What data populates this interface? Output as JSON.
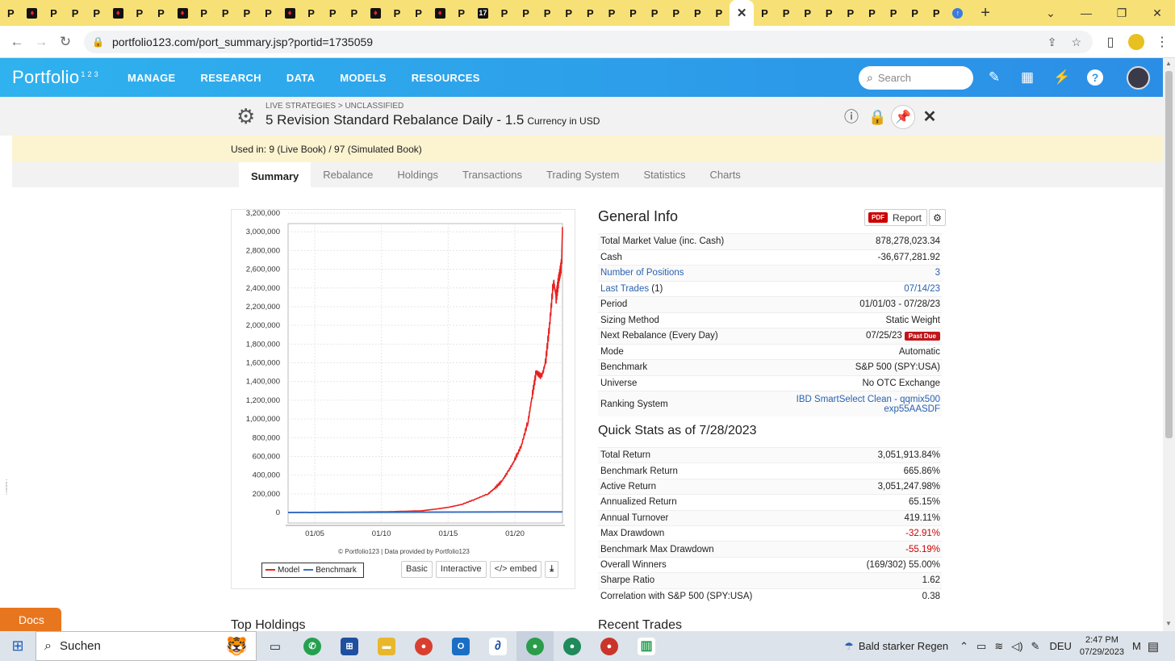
{
  "browser": {
    "tab_favicons": [
      "P",
      "r",
      "P",
      "P",
      "P",
      "r",
      "P",
      "P",
      "r",
      "P",
      "P",
      "P",
      "P",
      "r",
      "P",
      "P",
      "P",
      "r",
      "P",
      "P",
      "r",
      "P",
      "17",
      "P",
      "P",
      "P",
      "P",
      "P",
      "P",
      "P",
      "P",
      "P",
      "P",
      "P",
      "P",
      "P",
      "P",
      "P",
      "P",
      "P",
      "P",
      "P",
      "P",
      "g"
    ],
    "url": "portfolio123.com/port_summary.jsp?portid=1735059"
  },
  "site": {
    "logo_text": "Portfolio",
    "logo_sup": "1 2 3",
    "nav": [
      "MANAGE",
      "RESEARCH",
      "DATA",
      "MODELS",
      "RESOURCES"
    ],
    "search_placeholder": "Search"
  },
  "strategy": {
    "breadcrumb": "LIVE STRATEGIES > UNCLASSIFIED",
    "title": "5 Revision Standard Rebalance Daily - 1.5",
    "currency": "Currency in USD",
    "used_in": "Used in: 9 (Live Book) / 97 (Simulated Book)"
  },
  "tabs": [
    "Summary",
    "Rebalance",
    "Holdings",
    "Transactions",
    "Trading System",
    "Statistics",
    "Charts"
  ],
  "chart": {
    "credit": "© Portfolio123 | Data provided by Portfolio123",
    "legend_model": "Model",
    "legend_benchmark": "Benchmark",
    "buttons": [
      "Basic",
      "Interactive",
      "</> embed"
    ],
    "model_color": "#e8201f",
    "benchmark_color": "#3a6fc4"
  },
  "chart_data": {
    "type": "line",
    "title": "",
    "xlabel": "",
    "ylabel": "",
    "x_ticks": [
      "01/05",
      "01/10",
      "01/15",
      "01/20"
    ],
    "y_ticks": [
      "3,200,000",
      "3,000,000",
      "2,800,000",
      "2,600,000",
      "2,400,000",
      "2,200,000",
      "2,000,000",
      "1,800,000",
      "1,600,000",
      "1,400,000",
      "1,200,000",
      "1,000,000",
      "800,000",
      "600,000",
      "400,000",
      "200,000",
      "0"
    ],
    "ylim": [
      0,
      3200000
    ],
    "xlim": [
      "2003-01-01",
      "2023-07-28"
    ],
    "series": [
      {
        "name": "Model",
        "x": [
          2003,
          2008,
          2010,
          2011,
          2012,
          2013,
          2014,
          2015,
          2016,
          2017,
          2018,
          2018.5,
          2019,
          2019.5,
          2020,
          2020.5,
          2021,
          2021.3,
          2021.6,
          2022,
          2022.3,
          2022.6,
          2022.9,
          2023.1,
          2023.3,
          2023.5,
          2023.57
        ],
        "values": [
          0,
          5000,
          8000,
          10000,
          14000,
          18000,
          35000,
          55000,
          85000,
          140000,
          200000,
          260000,
          330000,
          440000,
          560000,
          720000,
          980000,
          1250000,
          1500000,
          1450000,
          1600000,
          2000000,
          2480000,
          2300000,
          2500000,
          2650000,
          3050000
        ]
      },
      {
        "name": "Benchmark",
        "x": [
          2003,
          2010,
          2015,
          2020,
          2023.57
        ],
        "values": [
          0,
          3000,
          4000,
          6000,
          7000
        ]
      }
    ],
    "grid": true,
    "legend": "bottom-left"
  },
  "general_info": {
    "title": "General Info",
    "report_label": "Report",
    "pdf_label": "PDF",
    "rows": [
      {
        "label": "Total Market Value (inc. Cash)",
        "value": "878,278,023.34"
      },
      {
        "label": "Cash",
        "value": "-36,677,281.92"
      },
      {
        "label": "Number of Positions",
        "value": "3",
        "link": true
      },
      {
        "label": "Last Trades",
        "suffix": "(1)",
        "value": "07/14/23",
        "link": true
      },
      {
        "label": "Period",
        "value": "01/01/03 - 07/28/23"
      },
      {
        "label": "Sizing Method",
        "value": "Static Weight"
      },
      {
        "label": "Next Rebalance (Every Day)",
        "value": "07/25/23",
        "badge": "Past Due"
      },
      {
        "label": "Mode",
        "value": "Automatic"
      },
      {
        "label": "Benchmark",
        "value": "S&P 500 (SPY:USA)"
      },
      {
        "label": "Universe",
        "value": "No OTC Exchange"
      },
      {
        "label": "Ranking System",
        "value": "IBD SmartSelect Clean - qqmix500",
        "value2": "exp55AASDF",
        "link": true
      }
    ]
  },
  "quick_stats": {
    "title": "Quick Stats as of 7/28/2023",
    "rows": [
      {
        "label": "Total Return",
        "value": "3,051,913.84%"
      },
      {
        "label": "Benchmark Return",
        "value": "665.86%"
      },
      {
        "label": "Active Return",
        "value": "3,051,247.98%"
      },
      {
        "label": "Annualized Return",
        "value": "65.15%"
      },
      {
        "label": "Annual Turnover",
        "value": "419.11%"
      },
      {
        "label": "Max Drawdown",
        "value": "-32.91%",
        "neg": true
      },
      {
        "label": "Benchmark Max Drawdown",
        "value": "-55.19%",
        "neg": true
      },
      {
        "label": "Overall Winners",
        "value": "(169/302) 55.00%"
      },
      {
        "label": "Sharpe Ratio",
        "value": "1.62"
      },
      {
        "label": "Correlation with S&P 500 (SPY:USA)",
        "value": "0.38"
      }
    ]
  },
  "sections": {
    "top_holdings": "Top Holdings",
    "recent_trades": "Recent Trades"
  },
  "docs_label": "Docs",
  "taskbar": {
    "search_label": "Suchen",
    "weather": "Bald starker Regen",
    "lang": "DEU",
    "time": "2:47 PM",
    "date": "07/29/2023"
  }
}
